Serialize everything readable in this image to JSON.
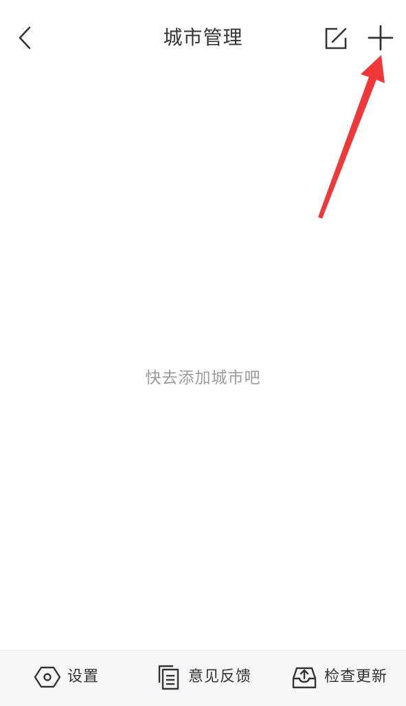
{
  "header": {
    "title": "城市管理",
    "back_icon": "chevron-left-icon",
    "edit_icon": "edit-icon",
    "add_icon": "plus-icon"
  },
  "main": {
    "empty_message": "快去添加城市吧"
  },
  "bottom_bar": {
    "items": [
      {
        "label": "设置",
        "icon": "hexagon-gear-icon"
      },
      {
        "label": "意见反馈",
        "icon": "document-icon"
      },
      {
        "label": "检查更新",
        "icon": "inbox-upload-icon"
      }
    ]
  },
  "annotation": {
    "arrow_color": "#f0383a"
  }
}
